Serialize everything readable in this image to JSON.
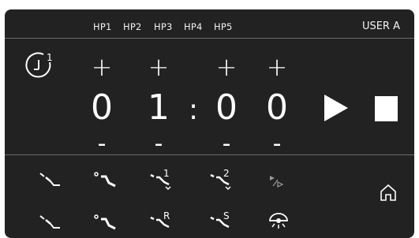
{
  "header": {
    "hp_tabs": [
      "HP1",
      "HP2",
      "HP3",
      "HP4",
      "HP5"
    ],
    "user_label": "USER A"
  },
  "timer": {
    "plus_label": "+",
    "minus_label": "-",
    "colon": ":",
    "digits": [
      "0",
      "1",
      "0",
      "0"
    ]
  },
  "instruments": {
    "row1": [
      {
        "icon": "scaler-tip-icon",
        "badge": ""
      },
      {
        "icon": "handpiece-icon",
        "badge": ""
      },
      {
        "icon": "handpiece-1-icon",
        "badge": "1"
      },
      {
        "icon": "handpiece-2-icon",
        "badge": "2"
      },
      {
        "icon": "forward-reverse-icon",
        "badge": ""
      }
    ],
    "row2": [
      {
        "icon": "scaler-tip-alt-icon",
        "badge": ""
      },
      {
        "icon": "handpiece-alt-icon",
        "badge": ""
      },
      {
        "icon": "handpiece-r-icon",
        "badge": "R"
      },
      {
        "icon": "handpiece-s-icon",
        "badge": "S"
      },
      {
        "icon": "operating-light-icon",
        "badge": ""
      }
    ]
  },
  "colors": {
    "panel_bg": "#222222",
    "foreground": "#ffffff",
    "separator": "#6b6b6b",
    "page_bg": "#ffffff"
  }
}
